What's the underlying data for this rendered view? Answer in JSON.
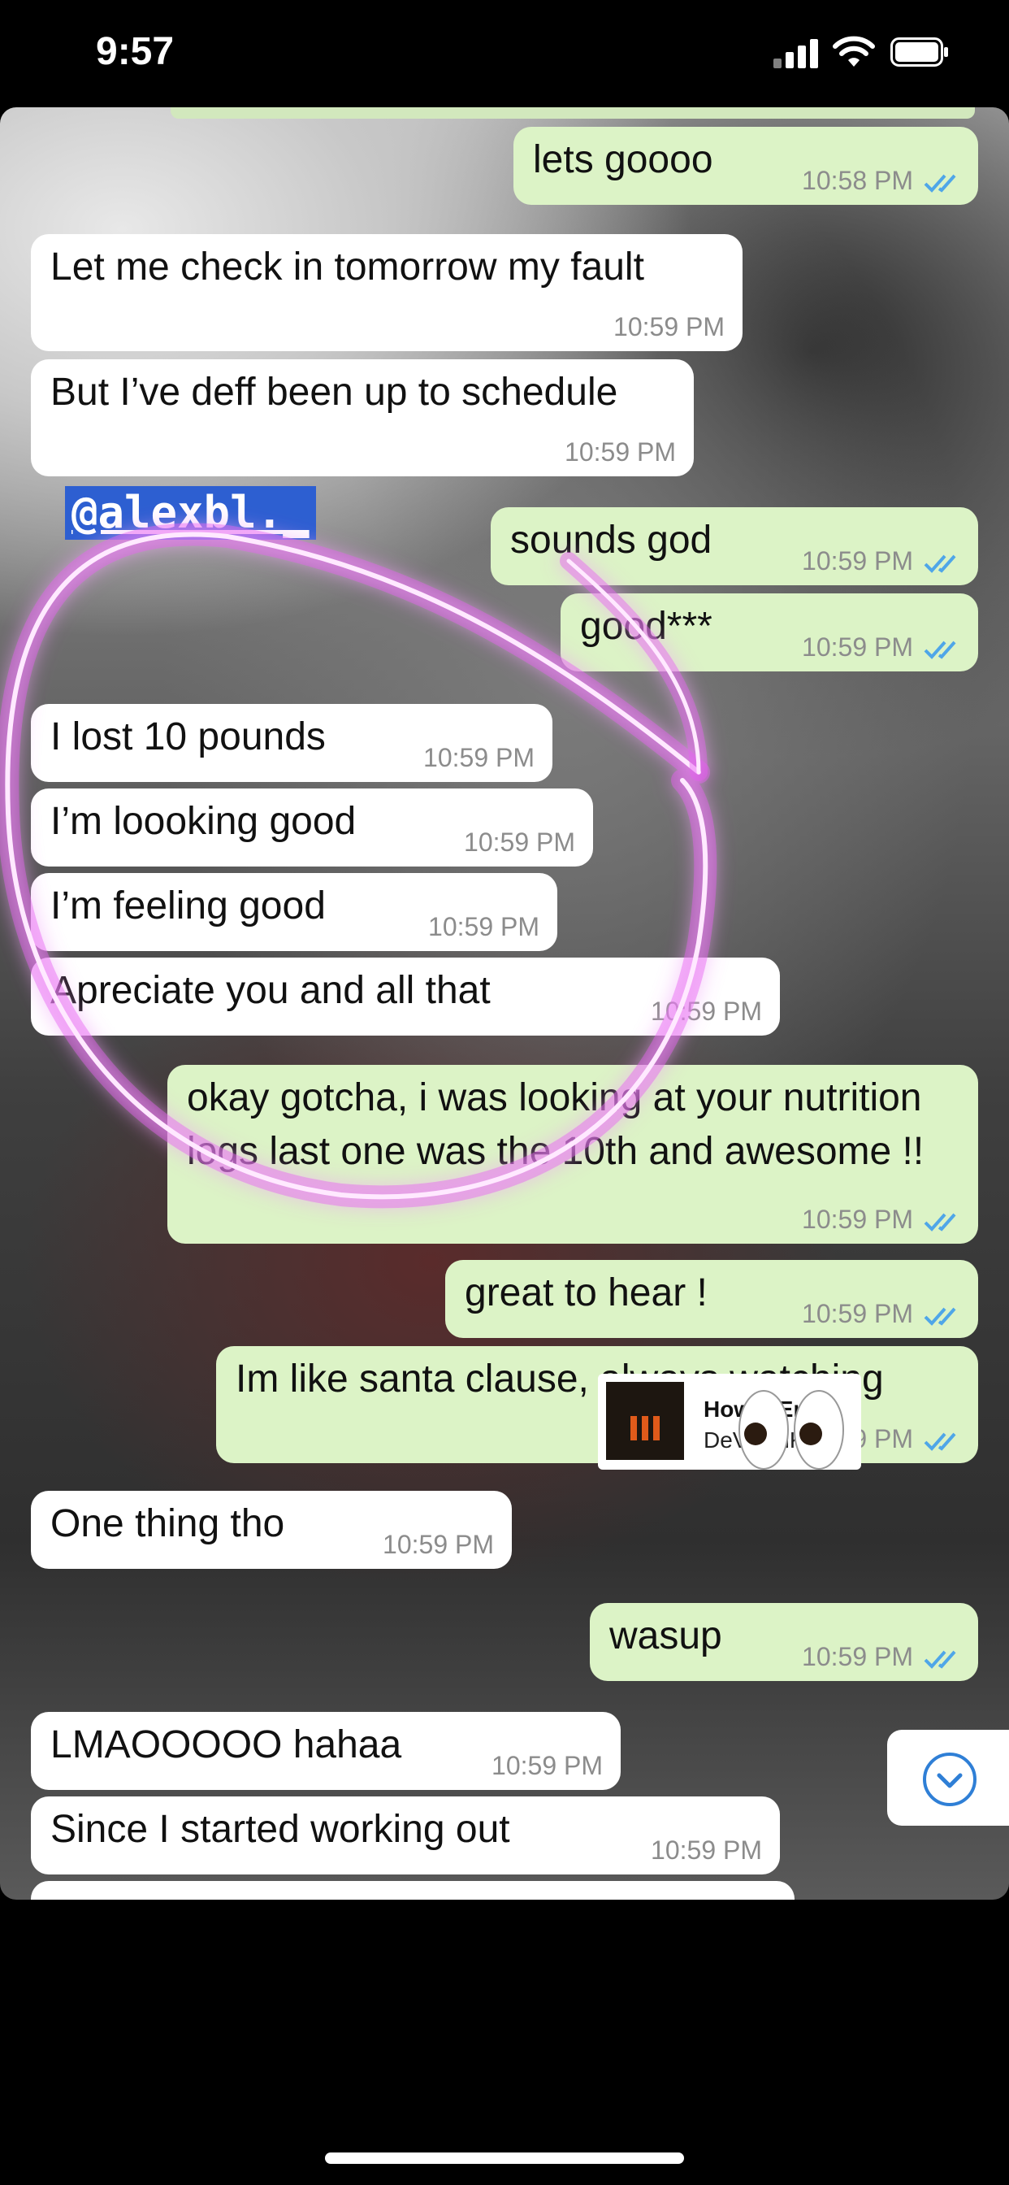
{
  "status": {
    "time": "9:57"
  },
  "mention": "@alexbl._",
  "music": {
    "title": "How It Ends",
    "artist": "DeVotchKa"
  },
  "messages": [
    {
      "dir": "out",
      "text": "lets goooo",
      "time": "10:58 PM"
    },
    {
      "dir": "in",
      "text": "Let me check in tomorrow my fault",
      "time": "10:59 PM"
    },
    {
      "dir": "in",
      "text": "But I’ve deff been up to schedule",
      "time": "10:59 PM"
    },
    {
      "dir": "out",
      "text": "sounds god",
      "time": "10:59 PM"
    },
    {
      "dir": "out",
      "text": "good***",
      "time": "10:59 PM"
    },
    {
      "dir": "in",
      "text": "I lost 10 pounds",
      "time": "10:59 PM"
    },
    {
      "dir": "in",
      "text": "I’m loooking good",
      "time": "10:59 PM"
    },
    {
      "dir": "in",
      "text": "I’m feeling good",
      "time": "10:59 PM"
    },
    {
      "dir": "in",
      "text": "Apreciate you and all that",
      "time": "10:59 PM"
    },
    {
      "dir": "out",
      "text": "okay gotcha, i was looking at your nutrition logs last one was the 10th and awesome !!",
      "time": "10:59 PM"
    },
    {
      "dir": "out",
      "text": "great to hear !",
      "time": "10:59 PM"
    },
    {
      "dir": "out",
      "text": "Im like santa clause, always watching",
      "time": "10:59 PM"
    },
    {
      "dir": "in",
      "text": "One thing tho",
      "time": "10:59 PM"
    },
    {
      "dir": "out",
      "text": "wasup",
      "time": "10:59 PM"
    },
    {
      "dir": "in",
      "text": "LMAOOOOO hahaa",
      "time": "10:59 PM"
    },
    {
      "dir": "in",
      "text": "Since I started working out",
      "time": "10:59 PM"
    }
  ],
  "colors": {
    "incoming": "#ffffff",
    "outgoing": "#dcf3c6",
    "read_ticks": "#4fa6e8",
    "scribble": "#e65cf2"
  }
}
